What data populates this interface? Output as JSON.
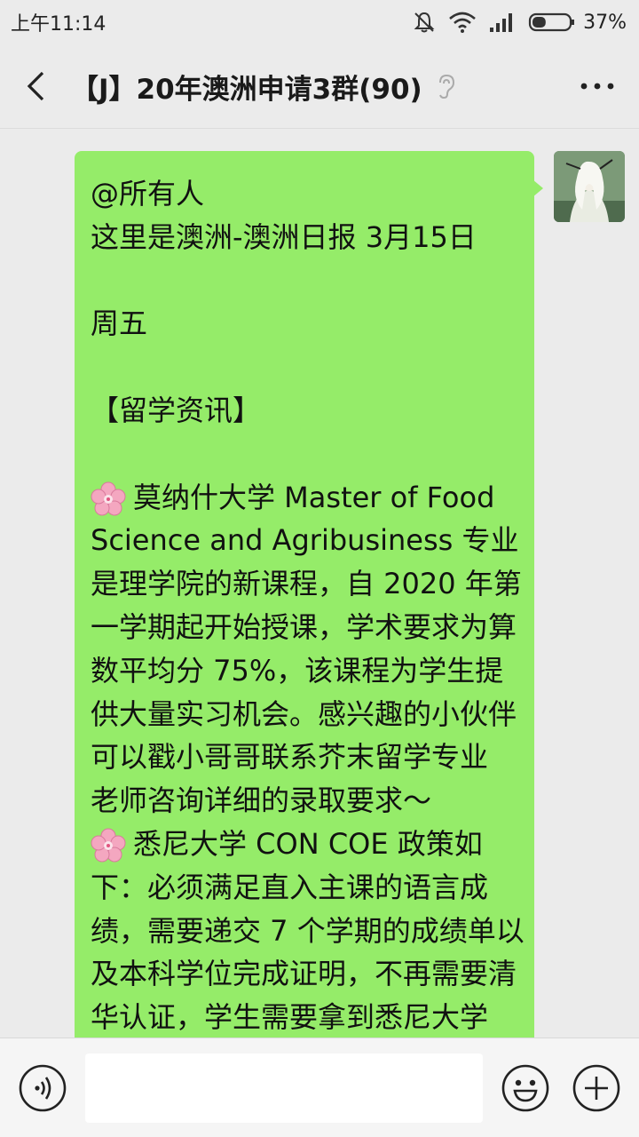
{
  "status_bar": {
    "time": "上午11:14",
    "battery_percent": "37%",
    "battery_level": 0.37
  },
  "header": {
    "title": "【J】20年澳洲申请3群(90)",
    "back_icon": "chevron-left-icon",
    "more_icon": "more-dots-icon",
    "mute_icon": "ear-icon"
  },
  "message": {
    "lines": {
      "l0": "@所有人",
      "l1": "这里是澳洲-澳洲日报 3月15日",
      "l3": "周五",
      "l5": "【留学资讯】",
      "l7": "莫纳什大学 Master of Food",
      "l8": "Science and Agribusiness 专业",
      "l9": "是理学院的新课程，自 2020 年第",
      "l10": "一学期起开始授课，学术要求为算",
      "l11": "数平均分 75%，该课程为学生提",
      "l12": "供大量实习机会。感兴趣的小伙伴",
      "l13": "可以戳小哥哥联系芥末留学专业",
      "l14": "老师咨询详细的录取要求～",
      "l15": "悉尼大学 CON COE 政策如",
      "l16": "下：必须满足直入主课的语言成",
      "l17": "绩，需要递交 7 个学期的成绩单以",
      "l18": "及本科学位完成证明，不再需要清",
      "l19": "华认证，学生需要拿到悉尼大学"
    }
  },
  "input_bar": {
    "placeholder": ""
  },
  "colors": {
    "bubble": "#95ec69",
    "background": "#ebebeb",
    "flower": "#f4a7c0"
  }
}
